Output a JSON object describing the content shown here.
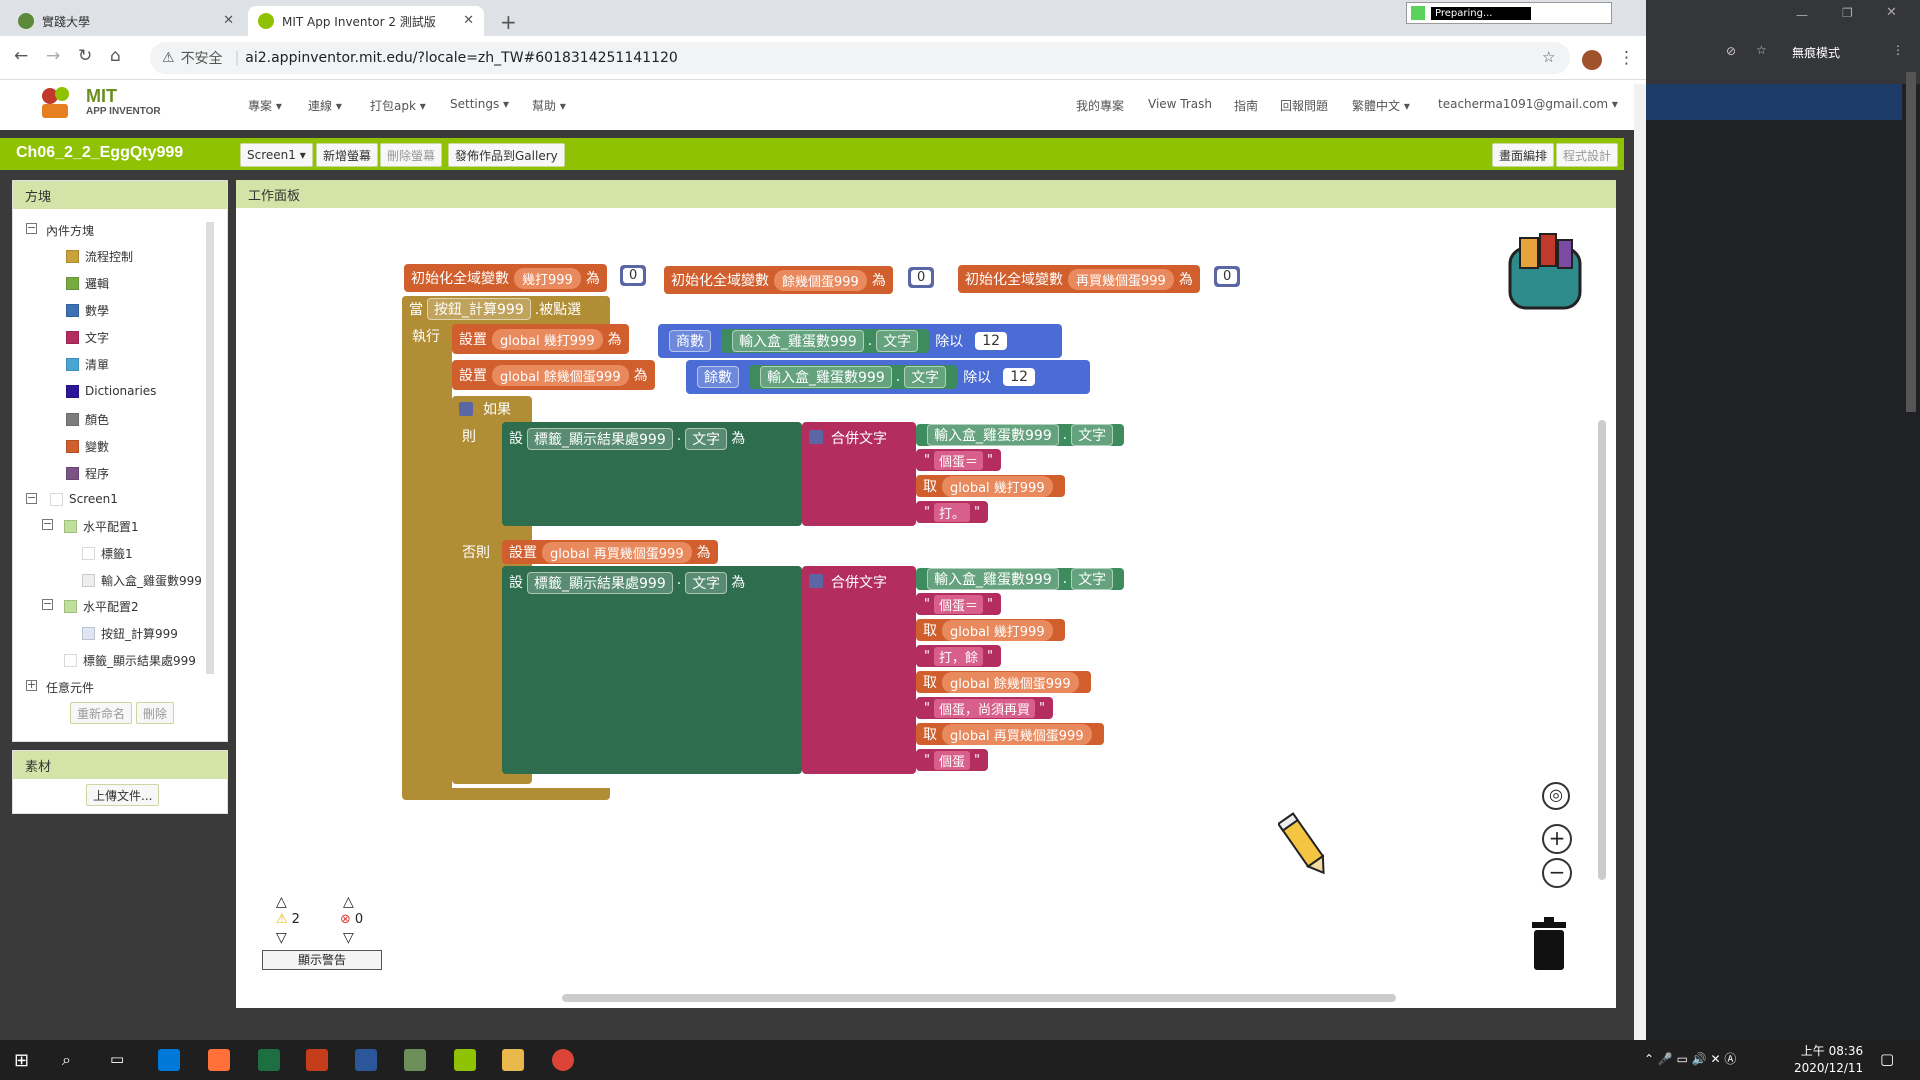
{
  "browser": {
    "tabs": [
      {
        "title": "實踐大學"
      },
      {
        "title": "MIT App Inventor 2 測試版"
      }
    ],
    "new_tab": "+",
    "security": "不安全",
    "url": "ai2.appinventor.mit.edu/?locale=zh_TW#6018314251141120",
    "incognito_label": "無痕模式",
    "preparing": "Preparing..."
  },
  "app": {
    "logo_line1": "MIT",
    "logo_line2": "APP INVENTOR",
    "menus": [
      "專案",
      "連線",
      "打包apk",
      "Settings",
      "幫助"
    ],
    "right_menus": [
      "我的專案",
      "View Trash",
      "指南",
      "回報問題",
      "繁體中文",
      "teacherma1091@gmail.com"
    ],
    "project_name": "Ch06_2_2_EggQty999",
    "screen_select": "Screen1",
    "btn_add_screen": "新增螢幕",
    "btn_remove_screen": "刪除螢幕",
    "btn_gallery": "發佈作品到Gallery",
    "btn_designer": "畫面編排",
    "btn_blocks": "程式設計"
  },
  "left_panel": {
    "title": "方塊",
    "builtin": "內件方塊",
    "builtin_items": [
      {
        "label": "流程控制",
        "color": "#c9a23b"
      },
      {
        "label": "邏輯",
        "color": "#77ab41"
      },
      {
        "label": "數學",
        "color": "#3f71b5"
      },
      {
        "label": "文字",
        "color": "#b32d5e"
      },
      {
        "label": "清單",
        "color": "#49a6d4"
      },
      {
        "label": "Dictionaries",
        "color": "#2d1799"
      },
      {
        "label": "顏色",
        "color": "#7d7d7d"
      },
      {
        "label": "變數",
        "color": "#d05f2d"
      },
      {
        "label": "程序",
        "color": "#7c5385"
      }
    ],
    "screen": "Screen1",
    "components": [
      "水平配置1",
      "標籤1",
      "輸入盒_雞蛋數999",
      "水平配置2",
      "按鈕_計算999",
      "標籤_顯示結果處999"
    ],
    "any_component": "任意元件",
    "btn_rename": "重新命名",
    "btn_delete": "刪除",
    "media_title": "素材",
    "upload": "上傳文件..."
  },
  "workspace": {
    "title": "工作面板",
    "init1": {
      "label": "初始化全域變數",
      "name": "幾打999",
      "as": "為",
      "value": "0"
    },
    "init2": {
      "label": "初始化全域變數",
      "name": "餘幾個蛋999",
      "as": "為",
      "value": "0"
    },
    "init3": {
      "label": "初始化全域變數",
      "name": "再買幾個蛋999",
      "as": "為",
      "value": "0"
    },
    "event": {
      "when": "當",
      "component": "按鈕_計算999",
      "event": ".被點選",
      "do": "執行"
    },
    "set1": {
      "set": "設置",
      "var": "global 幾打999",
      "as": "為",
      "op": "商數",
      "comp": "輸入盒_雞蛋數999",
      "prop": "文字",
      "div": "除以",
      "num": "12"
    },
    "set2": {
      "set": "設置",
      "var": "global 餘幾個蛋999",
      "as": "為",
      "op": "餘數",
      "comp": "輸入盒_雞蛋數999",
      "prop": "文字",
      "div": "除以",
      "num": "12"
    },
    "if": {
      "if": "如果",
      "then": "則",
      "else": "否則"
    },
    "then_set": {
      "set": "設",
      "comp": "標籤_顯示結果處999",
      "prop": "文字",
      "as": "為",
      "join": "合併文字",
      "in_comp": "輸入盒_雞蛋數999",
      "in_prop": "文字"
    },
    "then_items": [
      "個蛋＝",
      "取",
      "global 幾打999",
      "打。"
    ],
    "else_set0": {
      "set": "設置",
      "var": "global 再買幾個蛋999",
      "as": "為"
    },
    "else_set": {
      "set": "設",
      "comp": "標籤_顯示結果處999",
      "prop": "文字",
      "as": "為",
      "join": "合併文字",
      "in_comp": "輸入盒_雞蛋數999",
      "in_prop": "文字"
    },
    "else_items": [
      "個蛋＝",
      "取",
      "global 幾打999",
      "打，餘",
      "取",
      "global 餘幾個蛋999",
      "個蛋，尚須再買",
      "取",
      "global 再買幾個蛋999",
      "個蛋"
    ],
    "warnings": "2",
    "errors": "0",
    "show_warnings": "顯示警告"
  },
  "taskbar": {
    "time": "上午 08:36",
    "date": "2020/12/11"
  }
}
